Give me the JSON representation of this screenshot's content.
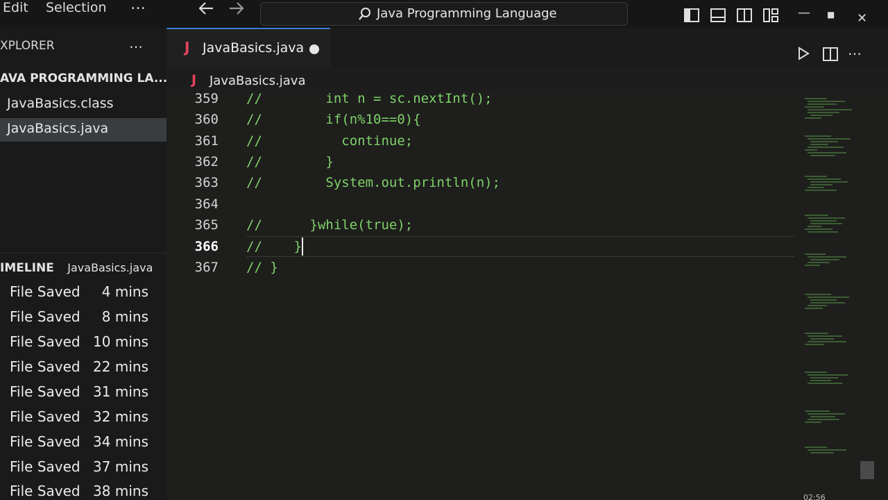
{
  "menu": {
    "edit": "Edit",
    "selection": "Selection",
    "more": "…"
  },
  "search": {
    "text": "Java Programming Language"
  },
  "window": {
    "minimize": "—",
    "restore": "■",
    "close": "✕"
  },
  "explorer": {
    "title": "XPLORER",
    "more": "…",
    "folder": "AVA PROGRAMMING LA...",
    "files": [
      {
        "label": "JavaBasics.class"
      },
      {
        "label": "JavaBasics.java"
      }
    ]
  },
  "timeline": {
    "title": "IMELINE",
    "file": "JavaBasics.java",
    "items": [
      {
        "label": "File Saved",
        "time": "4 mins"
      },
      {
        "label": "File Saved",
        "time": "8 mins"
      },
      {
        "label": "File Saved",
        "time": "10 mins"
      },
      {
        "label": "File Saved",
        "time": "22 mins"
      },
      {
        "label": "File Saved",
        "time": "31 mins"
      },
      {
        "label": "File Saved",
        "time": "32 mins"
      },
      {
        "label": "File Saved",
        "time": "34 mins"
      },
      {
        "label": "File Saved",
        "time": "37 mins"
      },
      {
        "label": "File Saved",
        "time": "38 mins"
      }
    ]
  },
  "tab": {
    "icon": "J",
    "label": "JavaBasics.java"
  },
  "breadcrumb": {
    "icon": "J",
    "label": "JavaBasics.java"
  },
  "editor": {
    "lines": [
      {
        "num": "359",
        "code": "//        int n = sc.nextInt();"
      },
      {
        "num": "360",
        "code": "//        if(n%10==0){"
      },
      {
        "num": "361",
        "code": "//          continue;"
      },
      {
        "num": "362",
        "code": "//        }"
      },
      {
        "num": "363",
        "code": "//        System.out.println(n);"
      },
      {
        "num": "364",
        "code": ""
      },
      {
        "num": "365",
        "code": "//      }while(true);"
      },
      {
        "num": "366",
        "code": "//    }"
      },
      {
        "num": "367",
        "code": "// }"
      }
    ],
    "active_line": "366"
  },
  "editor_actions": {
    "run": "▷",
    "split": "◫",
    "more": "…"
  },
  "status": {
    "time": "02:56"
  },
  "colors": {
    "accent": "#3c7dd8",
    "java_icon": "#e2445c",
    "comment_green": "#7fd36a"
  }
}
